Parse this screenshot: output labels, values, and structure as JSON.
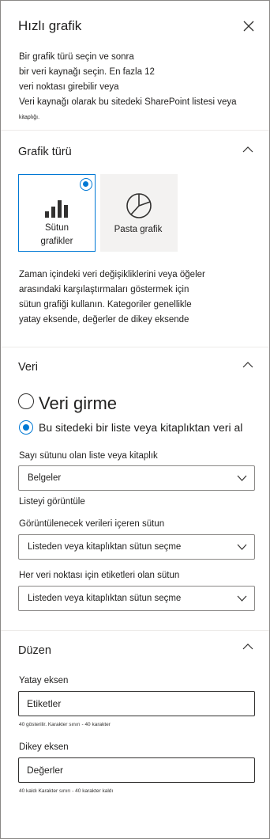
{
  "panel": {
    "title": "Hızlı grafik",
    "intro": {
      "line1": "Bir grafik türü seçin ve sonra",
      "line2": "bir veri kaynağı seçin. En fazla 12",
      "line3": "veri noktası girebilir veya",
      "line4": "Veri kaynağı olarak bu sitedeki SharePoint listesi veya",
      "line5": "kitaplığı."
    }
  },
  "chart_type": {
    "title": "Grafik türü",
    "options": [
      {
        "label_line1": "Sütun",
        "label_line2": "grafikler",
        "selected": true,
        "icon": "column-chart-icon"
      },
      {
        "label": "Pasta grafik",
        "selected": false,
        "icon": "pie-chart-icon"
      }
    ],
    "description": {
      "line1": "Zaman içindeki veri değişikliklerini veya öğeler",
      "line2": "arasındaki karşılaştırmaları göstermek için",
      "line3": "sütun grafiği kullanın. Kategoriler genellikle",
      "line4": "yatay eksende, değerler de dikey eksende"
    }
  },
  "data": {
    "title": "Veri",
    "option_manual": "Veri girme",
    "option_list": "Bu sitedeki bir liste veya kitaplıktan veri al",
    "list_label": "Sayı sütunu olan liste veya kitaplık",
    "list_value": "Belgeler",
    "view_list": "Listeyi görüntüle",
    "data_column_label": "Görüntülenecek verileri içeren sütun",
    "data_column_value": "Listeden veya kitaplıktan sütun seçme",
    "label_column_label": "Her veri noktası için etiketleri olan sütun",
    "label_column_value": "Listeden veya kitaplıktan sütun seçme"
  },
  "layout_section": {
    "title": "Düzen",
    "x_axis_label": "Yatay eksen",
    "x_axis_value": "Etiketler",
    "x_axis_hint": "40 gösterilir. Karakter sınırı - 40 karakter",
    "y_axis_label": "Dikey eksen",
    "y_axis_value": "Değerler",
    "y_axis_hint": "40 kaldı Karakter sınırı - 40 karakter kaldı"
  },
  "colors": {
    "accent": "#0078d4",
    "text": "#201f1e",
    "border": "#8a8886",
    "tile_bg": "#f3f2f1"
  }
}
